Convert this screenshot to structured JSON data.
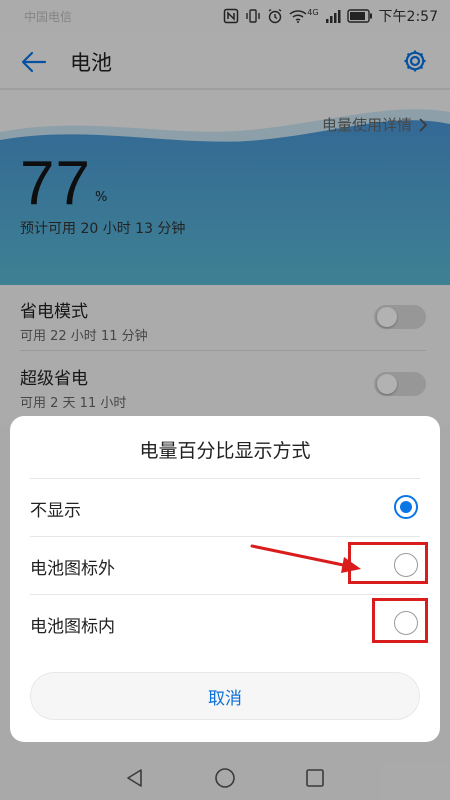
{
  "status_bar": {
    "carrier": "中国电信",
    "network": "4G",
    "time": "下午2:57"
  },
  "app_bar": {
    "title": "电池",
    "back_icon": "arrow-left-icon",
    "settings_icon": "gear-icon"
  },
  "battery": {
    "usage_details_link": "电量使用详情",
    "percent": "77",
    "percent_sign": "%",
    "estimate": "预计可用 20 小时 13 分钟"
  },
  "settings": [
    {
      "title": "省电模式",
      "subtitle": "可用 22 小时 11 分钟",
      "enabled": false
    },
    {
      "title": "超级省电",
      "subtitle": "可用 2 天 11 小时",
      "enabled": false
    }
  ],
  "dialog": {
    "title": "电量百分比显示方式",
    "options": [
      {
        "label": "不显示",
        "selected": true
      },
      {
        "label": "电池图标外",
        "selected": false
      },
      {
        "label": "电池图标内",
        "selected": false
      }
    ],
    "cancel_label": "取消"
  },
  "colors": {
    "accent": "#0a76e6",
    "banner_gradient_top": "#4a97d6",
    "banner_gradient_bottom": "#5ab9d3",
    "highlight": "#d91c1c"
  },
  "nav_bar": {
    "icons": [
      "back-triangle-icon",
      "home-circle-icon",
      "recents-square-icon"
    ]
  }
}
